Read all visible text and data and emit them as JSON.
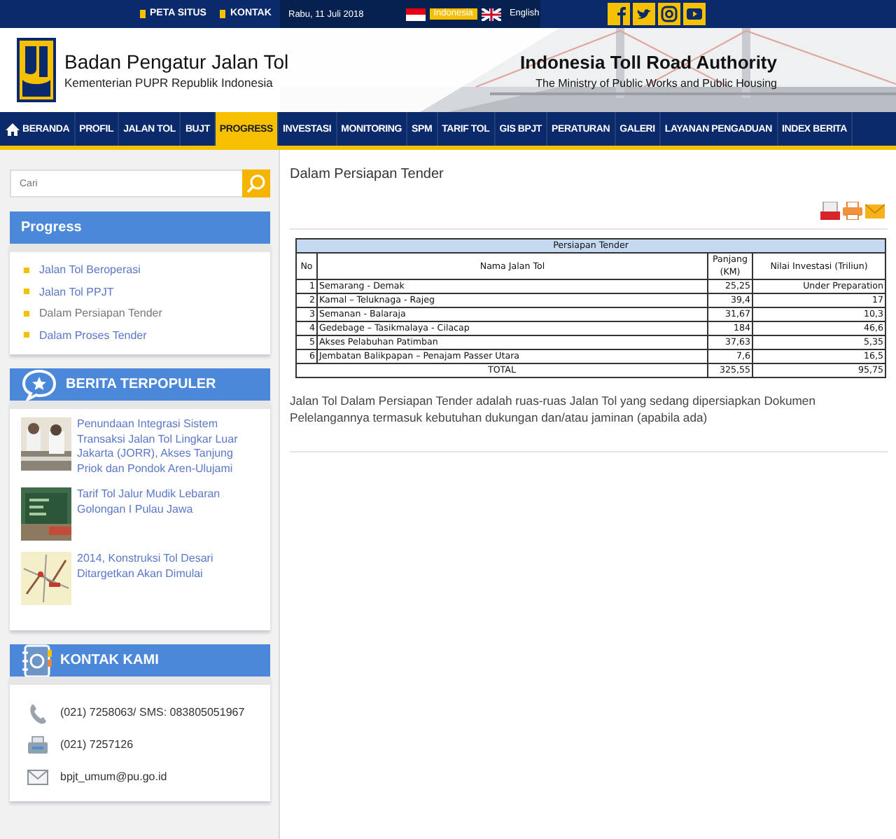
{
  "top_bar": {
    "links": [
      "PETA SITUS",
      "KONTAK"
    ],
    "date": "Rabu, 11 Juli 2018",
    "languages": [
      {
        "label": "Indonesia",
        "kind": "indonesia",
        "selected": true
      },
      {
        "label": "English",
        "kind": "britain",
        "selected": false
      }
    ]
  },
  "header": {
    "title": "Badan Pengatur Jalan Tol",
    "subtitle": "Kementerian PUPR Republik Indonesia",
    "en_title": "Indonesia Toll Road Authority",
    "en_subtitle": "The Ministry of Public Works and Public Housing"
  },
  "nav": [
    {
      "label": "BERANDA",
      "selected": false
    },
    {
      "label": "PROFIL",
      "selected": false
    },
    {
      "label": "JALAN TOL",
      "selected": false
    },
    {
      "label": "BUJT",
      "selected": false
    },
    {
      "label": "PROGRESS",
      "selected": true
    },
    {
      "label": "INVESTASI",
      "selected": false
    },
    {
      "label": "MONITORING",
      "selected": false
    },
    {
      "label": "SPM",
      "selected": false
    },
    {
      "label": "TARIF TOL",
      "selected": false
    },
    {
      "label": "GIS BPJT",
      "selected": false
    },
    {
      "label": "PERATURAN",
      "selected": false
    },
    {
      "label": "GALERI",
      "selected": false
    },
    {
      "label": "LAYANAN PENGADUAN",
      "selected": false
    },
    {
      "label": "INDEX BERITA",
      "selected": false
    }
  ],
  "sidebar": {
    "search": {
      "placeholder": "Cari"
    },
    "progress": {
      "title": "Progress",
      "items": [
        {
          "label": "Jalan Tol Beroperasi",
          "selected": false
        },
        {
          "label": "Jalan Tol PPJT",
          "selected": false
        },
        {
          "label": "Dalam Persiapan Tender",
          "selected": true
        },
        {
          "label": "Dalam Proses Tender",
          "selected": false
        }
      ]
    },
    "news": {
      "title": "BERITA TERPOPULER",
      "items": [
        {
          "title": "Penundaan Integrasi Sistem Transaksi Jalan Tol Lingkar Luar Jakarta (JORR), Akses Tanjung Priok dan Pondok Aren-Ulujami",
          "kind": "picture"
        },
        {
          "title": "Tarif Tol Jalur Mudik Lebaran Golongan I Pulau Jawa",
          "kind": "picture"
        },
        {
          "title": "2014, Konstruksi Tol Desari Ditargetkan Akan Dimulai",
          "kind": "picture"
        }
      ]
    },
    "contact": {
      "title": "KONTAK KAMI",
      "items": [
        {
          "kind": "phone",
          "text": "(021) 7258063/ SMS: 083805051967"
        },
        {
          "kind": "fax",
          "text": "(021) 7257126"
        },
        {
          "kind": "email",
          "text": "bpjt_umum@pu.go.id"
        }
      ]
    }
  },
  "main": {
    "page_title": "Dalam Persiapan Tender",
    "table": {
      "caption": "Persiapan Tender",
      "columns": [
        "No",
        "Nama Jalan Tol",
        "Panjang (KM)",
        "Nilai Investasi (Triliun)"
      ],
      "rows": [
        [
          "1",
          "Semarang - Demak",
          "25,25",
          "Under Preparation"
        ],
        [
          "2",
          "Kamal – Teluknaga - Rajeg",
          "39,4",
          "17"
        ],
        [
          "3",
          "Semanan - Balaraja",
          "31,67",
          "10,3"
        ],
        [
          "4",
          "Gedebage – Tasikmalaya - Cilacap",
          "184",
          "46,6"
        ],
        [
          "5",
          "Akses Pelabuhan Patimban",
          "37,63",
          "5,35"
        ],
        [
          "6",
          "Jembatan Balikpapan – Penajam Passer Utara",
          "7,6",
          "16,5"
        ]
      ],
      "total": {
        "label": "TOTAL",
        "length": "325,55",
        "investment": "95,75"
      }
    },
    "description": "Jalan Tol Dalam Persiapan Tender adalah ruas-ruas Jalan Tol yang sedang dipersiapkan Dokumen Pelelangannya termasuk kebutuhan dukungan dan/atau jaminan (apabila ada)"
  }
}
